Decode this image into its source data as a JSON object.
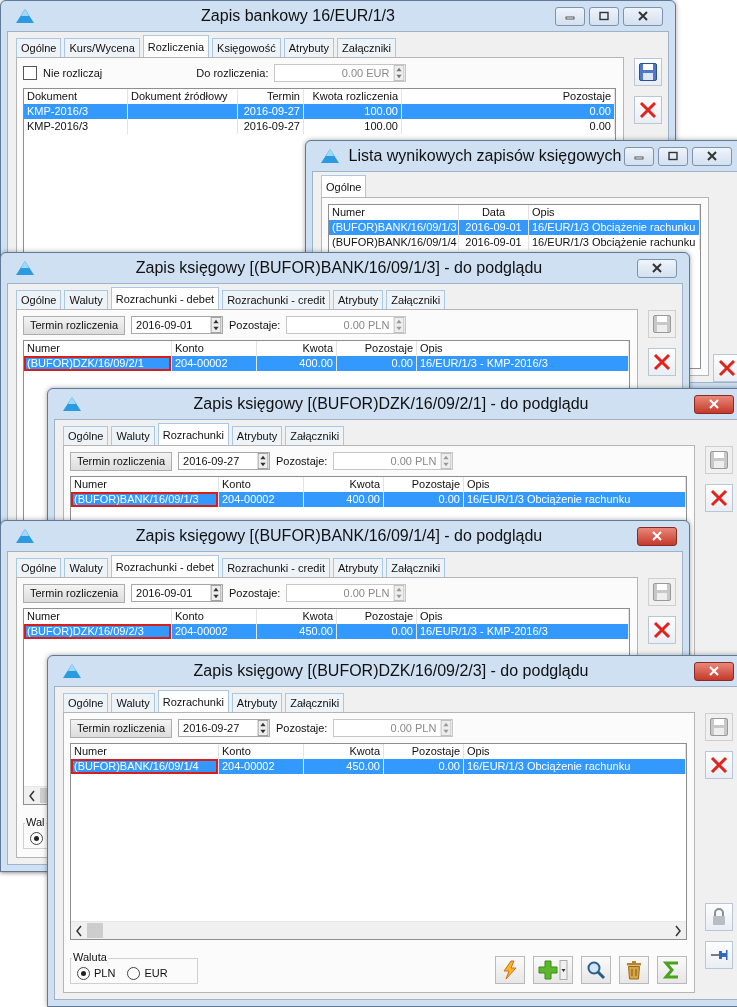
{
  "windows": [
    {
      "kind": "bank",
      "title": "Zapis bankowy 16/EUR/1/3",
      "active": false,
      "title_buttons": [
        {
          "kind": "minimize"
        },
        {
          "kind": "maximize"
        },
        {
          "kind": "close"
        }
      ],
      "tabs": [
        {
          "label": "Ogólne",
          "selected": false
        },
        {
          "label": "Kurs/Wycena",
          "selected": false
        },
        {
          "label": "Rozliczenia",
          "selected": true
        },
        {
          "label": "Księgowość",
          "selected": false
        },
        {
          "label": "Atrybuty",
          "selected": false
        },
        {
          "label": "Załączniki",
          "selected": false
        }
      ],
      "no_settle": {
        "label": "Nie rozliczaj",
        "checked": false
      },
      "to_settle": {
        "label": "Do rozliczenia:",
        "value": "0.00 EUR"
      },
      "columns": [
        "Dokument",
        "Dokument źródłowy",
        "Termin",
        "Kwota rozliczenia",
        "Pozostaje"
      ],
      "rows": [
        {
          "cells": [
            "KMP-2016/3",
            "",
            "2016-09-27",
            "100.00",
            "0.00"
          ],
          "selected": true,
          "marked": false
        },
        {
          "cells": [
            "KMP-2016/3",
            "",
            "2016-09-27",
            "100.00",
            "0.00"
          ],
          "selected": false,
          "marked": false
        }
      ],
      "side_buttons": [
        {
          "kind": "save",
          "disabled": false
        },
        {
          "kind": "delete",
          "disabled": false
        }
      ]
    },
    {
      "kind": "list",
      "title": "Lista wynikowych zapisów księgowych",
      "active": false,
      "title_buttons": [
        {
          "kind": "minimize"
        },
        {
          "kind": "maximize"
        },
        {
          "kind": "close"
        }
      ],
      "tabs": [
        {
          "label": "Ogólne",
          "selected": true
        }
      ],
      "columns": [
        "Numer",
        "Data",
        "Opis"
      ],
      "rows": [
        {
          "cells": [
            "(BUFOR)BANK/16/09/1/3",
            "2016-09-01",
            "16/EUR/1/3 Obciążenie rachunku"
          ],
          "selected": true,
          "marked": false
        },
        {
          "cells": [
            "(BUFOR)BANK/16/09/1/4",
            "2016-09-01",
            "16/EUR/1/3 Obciążenie rachunku"
          ],
          "selected": false,
          "marked": false
        }
      ],
      "side_buttons": [
        {
          "kind": "delete",
          "disabled": false
        }
      ]
    },
    {
      "kind": "entry",
      "title": "Zapis księgowy [(BUFOR)BANK/16/09/1/3] - do podglądu",
      "active": false,
      "title_buttons": [
        {
          "kind": "close"
        }
      ],
      "tabs": [
        {
          "label": "Ogólne",
          "selected": false
        },
        {
          "label": "Waluty",
          "selected": false
        },
        {
          "label": "Rozrachunki - debet",
          "selected": true
        },
        {
          "label": "Rozrachunki - credit",
          "selected": false
        },
        {
          "label": "Atrybuty",
          "selected": false
        },
        {
          "label": "Załączniki",
          "selected": false
        }
      ],
      "due_button": "Termin rozliczenia",
      "due_date": "2016-09-01",
      "remaining": {
        "label": "Pozostaje:",
        "value": "0.00 PLN"
      },
      "columns": [
        "Numer",
        "Konto",
        "Kwota",
        "Pozostaje",
        "Opis"
      ],
      "rows": [
        {
          "cells": [
            "(BUFOR)DZK/16/09/2/1",
            "204-00002",
            "400.00",
            "0.00",
            "16/EUR/1/3 - KMP-2016/3"
          ],
          "selected": true,
          "marked": true
        }
      ],
      "side_buttons": [
        {
          "kind": "save",
          "disabled": true
        },
        {
          "kind": "delete",
          "disabled": false
        }
      ]
    },
    {
      "kind": "entry",
      "title": "Zapis księgowy [(BUFOR)DZK/16/09/2/1] - do podglądu",
      "active": true,
      "title_buttons": [
        {
          "kind": "close"
        }
      ],
      "tabs": [
        {
          "label": "Ogólne",
          "selected": false
        },
        {
          "label": "Waluty",
          "selected": false
        },
        {
          "label": "Rozrachunki",
          "selected": true
        },
        {
          "label": "Atrybuty",
          "selected": false
        },
        {
          "label": "Załączniki",
          "selected": false
        }
      ],
      "due_button": "Termin rozliczenia",
      "due_date": "2016-09-27",
      "remaining": {
        "label": "Pozostaje:",
        "value": "0.00 PLN"
      },
      "columns": [
        "Numer",
        "Konto",
        "Kwota",
        "Pozostaje",
        "Opis"
      ],
      "rows": [
        {
          "cells": [
            "(BUFOR)BANK/16/09/1/3",
            "204-00002",
            "400.00",
            "0.00",
            "16/EUR/1/3 Obciążenie rachunku"
          ],
          "selected": true,
          "marked": true
        }
      ],
      "side_buttons": [
        {
          "kind": "save",
          "disabled": true
        },
        {
          "kind": "delete",
          "disabled": false
        }
      ]
    },
    {
      "kind": "entry",
      "title": "Zapis księgowy [(BUFOR)BANK/16/09/1/4] - do podglądu",
      "active": true,
      "title_buttons": [
        {
          "kind": "close"
        }
      ],
      "tabs": [
        {
          "label": "Ogólne",
          "selected": false
        },
        {
          "label": "Waluty",
          "selected": false
        },
        {
          "label": "Rozrachunki - debet",
          "selected": true
        },
        {
          "label": "Rozrachunki - credit",
          "selected": false
        },
        {
          "label": "Atrybuty",
          "selected": false
        },
        {
          "label": "Załączniki",
          "selected": false
        }
      ],
      "due_button": "Termin rozliczenia",
      "due_date": "2016-09-01",
      "remaining": {
        "label": "Pozostaje:",
        "value": "0.00 PLN"
      },
      "columns": [
        "Numer",
        "Konto",
        "Kwota",
        "Pozostaje",
        "Opis"
      ],
      "rows": [
        {
          "cells": [
            "(BUFOR)DZK/16/09/2/3",
            "204-00002",
            "450.00",
            "0.00",
            "16/EUR/1/3 - KMP-2016/3"
          ],
          "selected": true,
          "marked": true
        }
      ],
      "currency": {
        "legend": "Wal",
        "options": [
          {
            "selected": true
          }
        ]
      },
      "side_buttons": [
        {
          "kind": "save",
          "disabled": true
        },
        {
          "kind": "delete",
          "disabled": false
        }
      ]
    },
    {
      "kind": "entry",
      "title": "Zapis księgowy [(BUFOR)DZK/16/09/2/3] - do podglądu",
      "active": true,
      "title_buttons": [
        {
          "kind": "close"
        }
      ],
      "tabs": [
        {
          "label": "Ogólne",
          "selected": false
        },
        {
          "label": "Waluty",
          "selected": false
        },
        {
          "label": "Rozrachunki",
          "selected": true
        },
        {
          "label": "Atrybuty",
          "selected": false
        },
        {
          "label": "Załączniki",
          "selected": false
        }
      ],
      "due_button": "Termin rozliczenia",
      "due_date": "2016-09-27",
      "remaining": {
        "label": "Pozostaje:",
        "value": "0.00 PLN"
      },
      "columns": [
        "Numer",
        "Konto",
        "Kwota",
        "Pozostaje",
        "Opis"
      ],
      "rows": [
        {
          "cells": [
            "(BUFOR)BANK/16/09/1/4",
            "204-00002",
            "450.00",
            "0.00",
            "16/EUR/1/3 Obciążenie rachunku"
          ],
          "selected": true,
          "marked": true
        }
      ],
      "currency": {
        "legend": "Waluta",
        "options": [
          {
            "label": "PLN",
            "selected": true
          },
          {
            "label": "EUR",
            "selected": false
          }
        ]
      },
      "toolbar": [
        {
          "kind": "generate"
        },
        {
          "kind": "add"
        },
        {
          "kind": "preview"
        },
        {
          "kind": "delete"
        },
        {
          "kind": "sum"
        }
      ],
      "side_buttons": [
        {
          "kind": "save",
          "disabled": true
        },
        {
          "kind": "delete",
          "disabled": false
        },
        {
          "kind": "lock",
          "disabled": false
        },
        {
          "kind": "pin",
          "disabled": false
        }
      ]
    }
  ]
}
